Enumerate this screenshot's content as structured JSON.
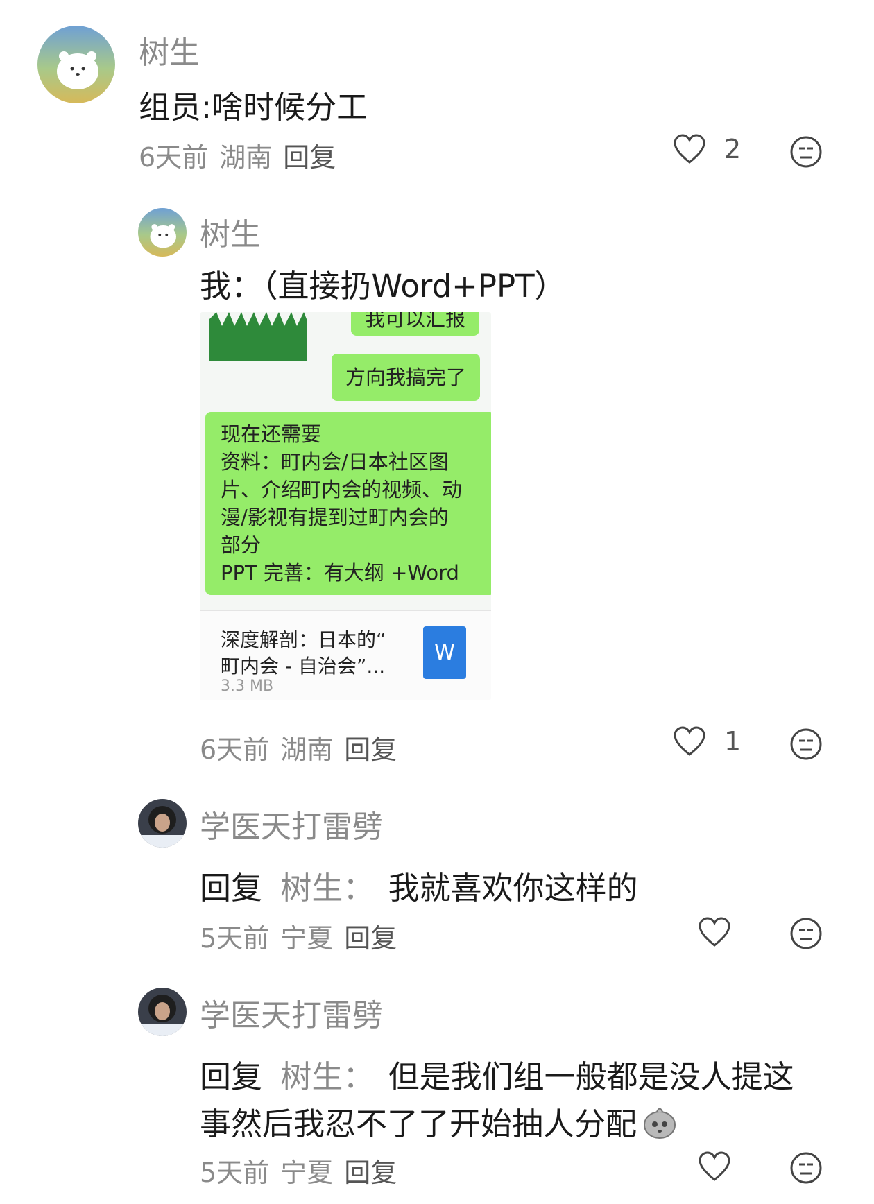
{
  "comments": [
    {
      "username": "树生",
      "text": "组员:啥时候分工",
      "time": "6天前",
      "location": "湖南",
      "reply_label": "回复",
      "likes": "2"
    },
    {
      "username": "树生",
      "text": "我：（直接扔Word+PPT）",
      "time": "6天前",
      "location": "湖南",
      "reply_label": "回复",
      "likes": "1",
      "image": {
        "top_bubble": "我可以汇报",
        "bubble_2": "方向我搞完了",
        "bubble_3_lines": [
          "现在还需要",
          "资料：町内会/日本社区图",
          "片、介绍町内会的视频、动",
          "漫/影视有提到过町内会的",
          "部分",
          "PPT 完善：有大纲 +Word"
        ],
        "file_title_1": "深度解剖：日本的“",
        "file_title_2": "町内会 - 自治会”...",
        "file_size": "3.3 MB",
        "file_icon_letter": "W"
      }
    },
    {
      "username": "学医天打雷劈",
      "reply_prefix": "回复",
      "reply_to": "树生：",
      "text": "我就喜欢你这样的",
      "time": "5天前",
      "location": "宁夏",
      "reply_label": "回复"
    },
    {
      "username": "学医天打雷劈",
      "reply_prefix": "回复",
      "reply_to": "树生：",
      "text_line1": "但是我们组一般都是没人提这",
      "text_line2": "事然后我忍不了了开始抽人分配",
      "time": "5天前",
      "location": "宁夏",
      "reply_label": "回复"
    }
  ],
  "icons": {
    "like": "heart-outline-icon",
    "dislike": "neutral-face-icon"
  }
}
